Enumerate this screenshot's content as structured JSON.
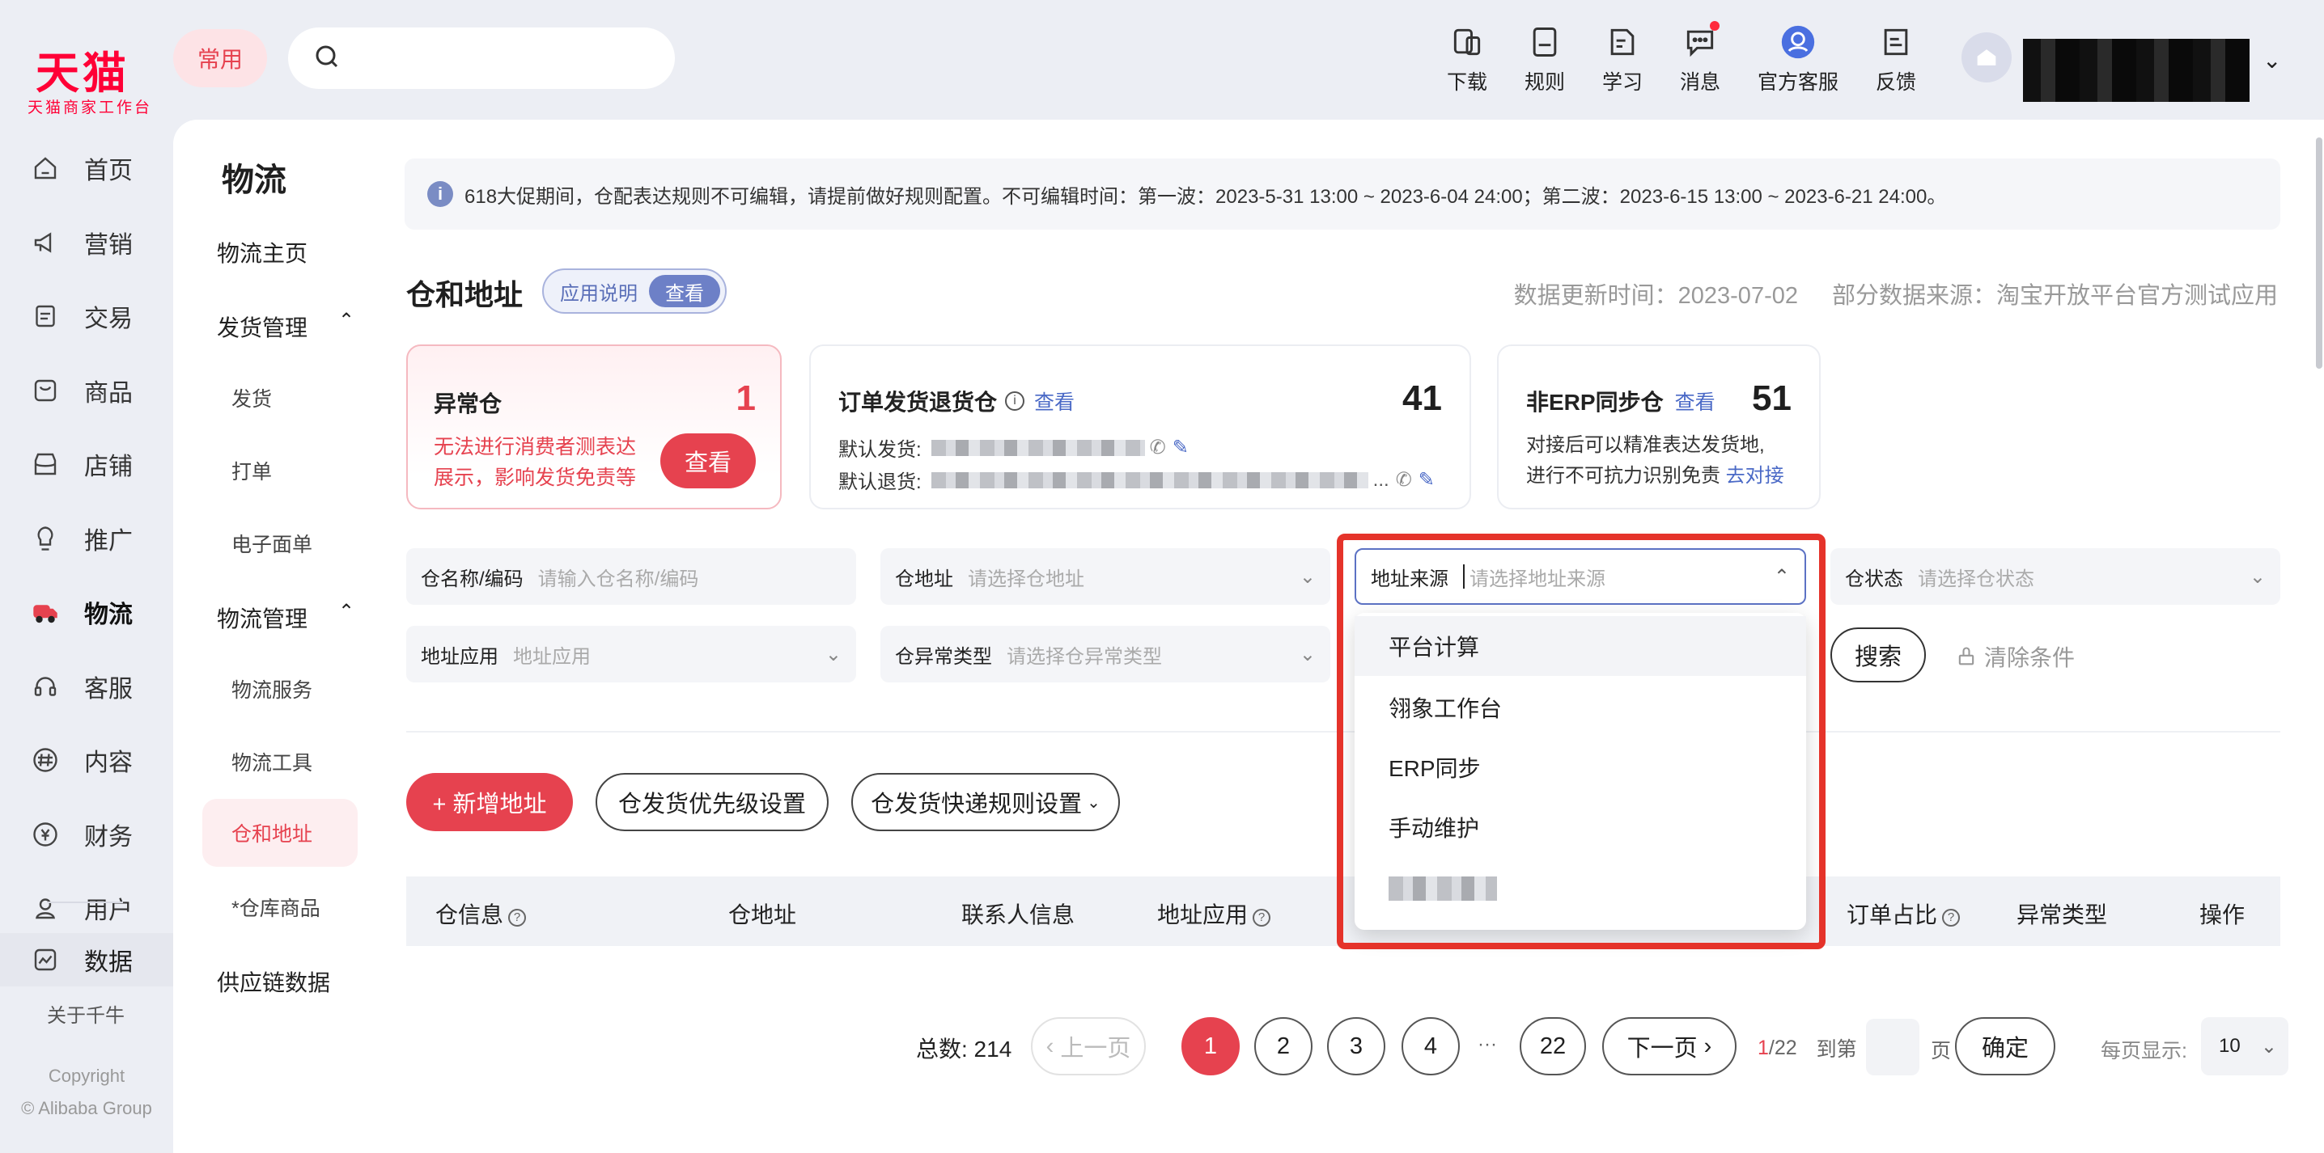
{
  "brand": {
    "name": "天猫",
    "subtitle": "天猫商家工作台"
  },
  "topbar": {
    "frequent_label": "常用",
    "search_placeholder": "",
    "icons": [
      {
        "label": "下载",
        "icon": "download-icon"
      },
      {
        "label": "规则",
        "icon": "rules-icon"
      },
      {
        "label": "学习",
        "icon": "learn-icon"
      },
      {
        "label": "消息",
        "icon": "message-icon",
        "has_dot": true
      },
      {
        "label": "官方客服",
        "icon": "service-icon"
      },
      {
        "label": "反馈",
        "icon": "feedback-icon"
      }
    ]
  },
  "sidebar": {
    "items": [
      {
        "label": "首页",
        "icon": "home-icon"
      },
      {
        "label": "营销",
        "icon": "megaphone-icon"
      },
      {
        "label": "交易",
        "icon": "trade-icon"
      },
      {
        "label": "商品",
        "icon": "goods-icon"
      },
      {
        "label": "店铺",
        "icon": "shop-icon"
      },
      {
        "label": "推广",
        "icon": "promote-icon"
      },
      {
        "label": "物流",
        "icon": "logistics-icon",
        "active": true
      },
      {
        "label": "客服",
        "icon": "headset-icon"
      },
      {
        "label": "内容",
        "icon": "content-icon"
      },
      {
        "label": "财务",
        "icon": "finance-icon"
      },
      {
        "label": "用户",
        "icon": "user-icon"
      }
    ],
    "data_label": "数据",
    "about_label": "关于千牛",
    "copyright_1": "Copyright",
    "copyright_2": "© Alibaba Group"
  },
  "subnav": {
    "title": "物流",
    "home": "物流主页",
    "ship_group": "发货管理",
    "ship_children": [
      "发货",
      "打单",
      "电子面单"
    ],
    "manage_group": "物流管理",
    "manage_children": [
      "物流服务",
      "物流工具",
      "仓和地址",
      "*仓库商品"
    ],
    "supply": "供应链数据"
  },
  "notice": "618大促期间，仓配表达规则不可编辑，请提前做好规则配置。不可编辑时间：第一波：2023-5-31 13:00 ~ 2023-6-04 24:00；第二波：2023-6-15 13:00 ~ 2023-6-21 24:00。",
  "section": {
    "title": "仓和地址",
    "app_note": "应用说明",
    "app_check": "查看",
    "update_time": "数据更新时间：2023-07-02",
    "data_source": "部分数据来源：淘宝开放平台官方测试应用"
  },
  "cards": {
    "abnormal": {
      "title": "异常仓",
      "count": "1",
      "desc_1": "无法进行消费者测表达",
      "desc_2": "展示，影响发货免责等",
      "button": "查看"
    },
    "order": {
      "title": "订单发货退货仓",
      "link": "查看",
      "count": "41",
      "ship_label": "默认发货:",
      "return_label": "默认退货:",
      "ellipsis": "..."
    },
    "non_erp": {
      "title": "非ERP同步仓",
      "link": "查看",
      "count": "51",
      "desc_1": "对接后可以精准表达发货地,",
      "desc_2": "进行不可抗力识别免责",
      "connect": "去对接"
    }
  },
  "filters": {
    "name": {
      "label": "仓名称/编码",
      "placeholder": "请输入仓名称/编码"
    },
    "address": {
      "label": "仓地址",
      "placeholder": "请选择仓地址"
    },
    "source": {
      "label": "地址来源",
      "placeholder": "请选择地址来源"
    },
    "status": {
      "label": "仓状态",
      "placeholder": "请选择仓状态"
    },
    "usage": {
      "label": "地址应用",
      "placeholder": "地址应用"
    },
    "abnormal_type": {
      "label": "仓异常类型",
      "placeholder": "请选择仓异常类型"
    },
    "search": "搜索",
    "clear": "清除条件"
  },
  "dropdown_options": [
    "平台计算",
    "翎象工作台",
    "ERP同步",
    "手动维护"
  ],
  "actions": {
    "add": "+ 新增地址",
    "priority": "仓发货优先级设置",
    "rules": "仓发货快递规则设置"
  },
  "table_headers": [
    "仓信息",
    "仓地址",
    "联系人信息",
    "地址应用",
    "订单占比",
    "异常类型",
    "操作"
  ],
  "pagination": {
    "total": "总数: 214",
    "prev": "上一页",
    "pages": [
      "1",
      "2",
      "3",
      "4",
      "22"
    ],
    "ellipsis": "···",
    "next": "下一页",
    "current": "1",
    "total_pages": "/22",
    "goto": "到第",
    "page_unit": "页",
    "confirm": "确定",
    "per_page_label": "每页显示:",
    "per_page": "10"
  }
}
